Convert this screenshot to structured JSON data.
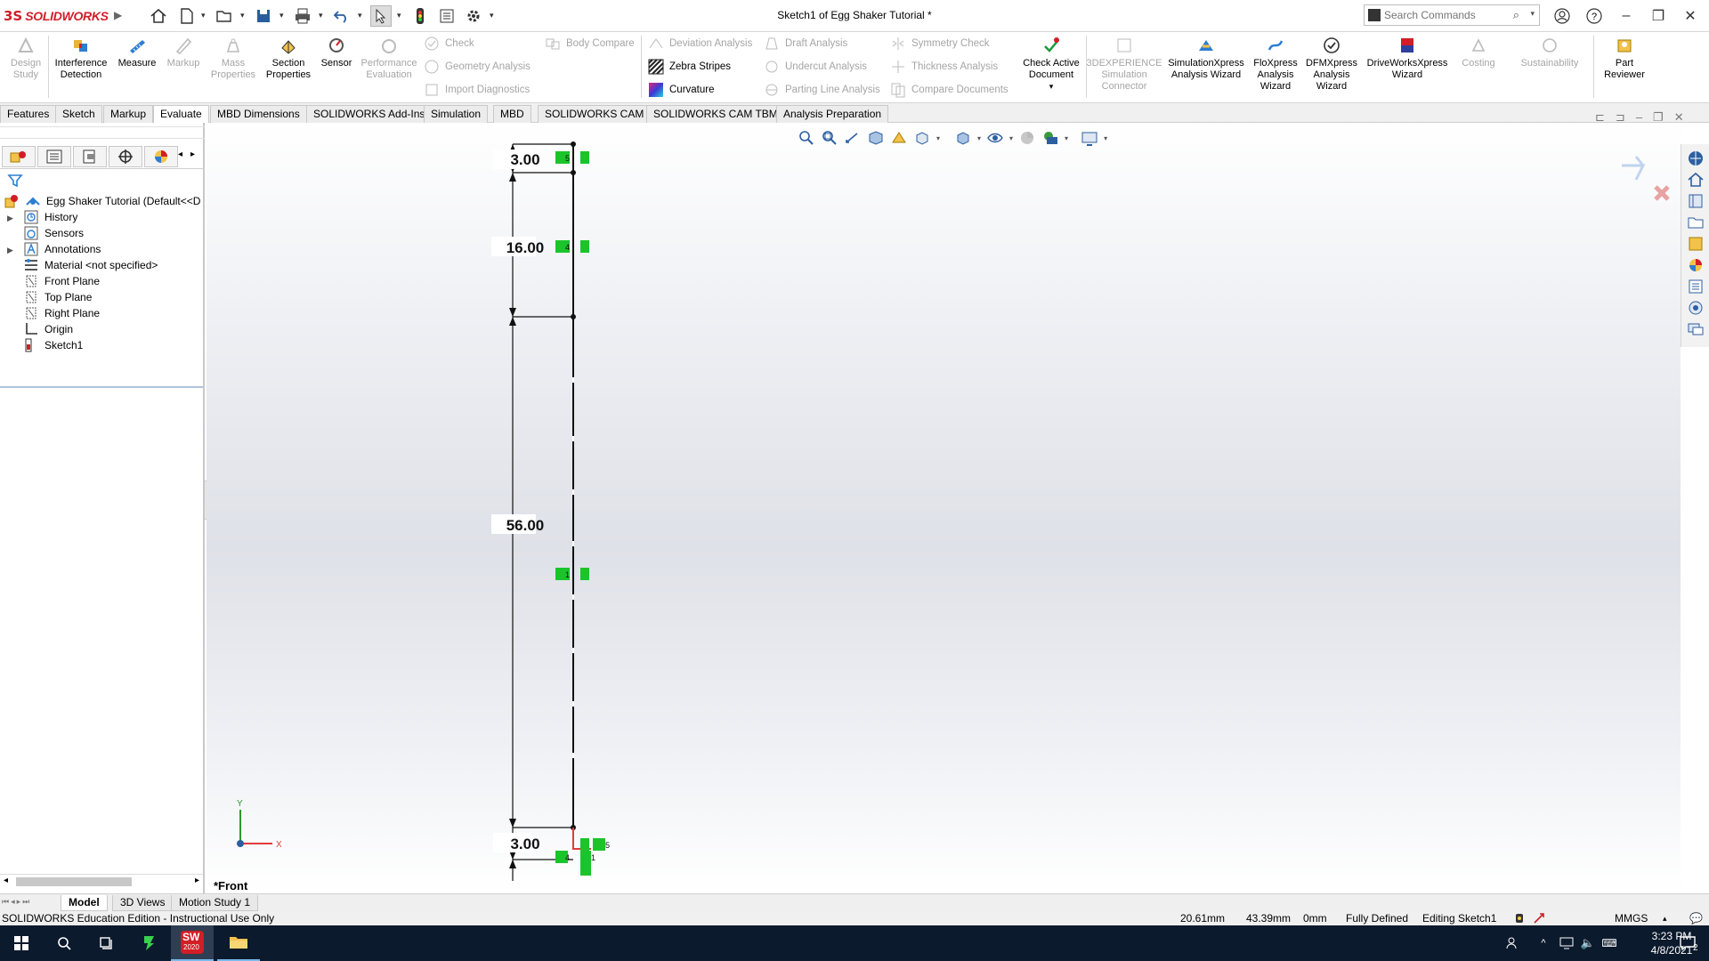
{
  "app": {
    "logo_ds": "3S",
    "logo_text": "SOLIDWORKS",
    "doc_title": "Sketch1 of Egg Shaker Tutorial *",
    "search_placeholder": "Search Commands"
  },
  "ribbon": {
    "design_study": "Design Study",
    "interference_detection": "Interference Detection",
    "measure": "Measure",
    "markup": "Markup",
    "mass_properties": "Mass Properties",
    "section_properties": "Section Properties",
    "sensor": "Sensor",
    "performance_evaluation": "Performance Evaluation",
    "check": "Check",
    "geometry_analysis": "Geometry Analysis",
    "import_diagnostics": "Import Diagnostics",
    "body_compare": "Body Compare",
    "deviation_analysis": "Deviation Analysis",
    "zebra_stripes": "Zebra Stripes",
    "curvature": "Curvature",
    "draft_analysis": "Draft Analysis",
    "undercut_analysis": "Undercut Analysis",
    "parting_line_analysis": "Parting Line Analysis",
    "symmetry_check": "Symmetry Check",
    "thickness_analysis": "Thickness Analysis",
    "compare_documents": "Compare Documents",
    "check_active_document": "Check Active Document",
    "experience_sim": "3DEXPERIENCE Simulation Connector",
    "simxpress": "SimulationXpress Analysis Wizard",
    "floxpress": "FloXpress Analysis Wizard",
    "dfmxpress": "DFMXpress Analysis Wizard",
    "driveworks": "DriveWorksXpress Wizard",
    "costing": "Costing",
    "sustainability": "Sustainability",
    "part_reviewer": "Part Reviewer"
  },
  "tabs": [
    "Features",
    "Sketch",
    "Markup",
    "Evaluate",
    "MBD Dimensions",
    "SOLIDWORKS Add-Ins",
    "Simulation",
    "MBD",
    "SOLIDWORKS CAM",
    "SOLIDWORKS CAM TBM",
    "Analysis Preparation"
  ],
  "tree": {
    "root": "Egg Shaker Tutorial  (Default<<D",
    "items": [
      "History",
      "Sensors",
      "Annotations",
      "Material <not specified>",
      "Front Plane",
      "Top Plane",
      "Right Plane",
      "Origin",
      "Sketch1"
    ]
  },
  "sketch": {
    "dims": [
      "3.00",
      "16.00",
      "56.00",
      "3.00"
    ],
    "relation_labels": [
      "5",
      "4",
      "1",
      "5",
      "4",
      "1"
    ]
  },
  "viewport": {
    "view_label": "*Front",
    "triad_y": "Y",
    "triad_x": "X"
  },
  "bottom_tabs": [
    "Model",
    "3D Views",
    "Motion Study 1"
  ],
  "status": {
    "edition": "SOLIDWORKS Education Edition - Instructional Use Only",
    "x": "20.61mm",
    "y": "43.39mm",
    "z": "0mm",
    "state": "Fully Defined",
    "editing": "Editing Sketch1",
    "units": "MMGS"
  },
  "taskbar": {
    "time": "3:23 PM",
    "date": "4/8/2021",
    "notif_count": "2",
    "sw_badge": "2020"
  },
  "colors": {
    "brand": "#d11e27",
    "relation_green": "#1bc42b",
    "origin_red": "#e23b3b",
    "taskbar": "#0b1a2c"
  }
}
